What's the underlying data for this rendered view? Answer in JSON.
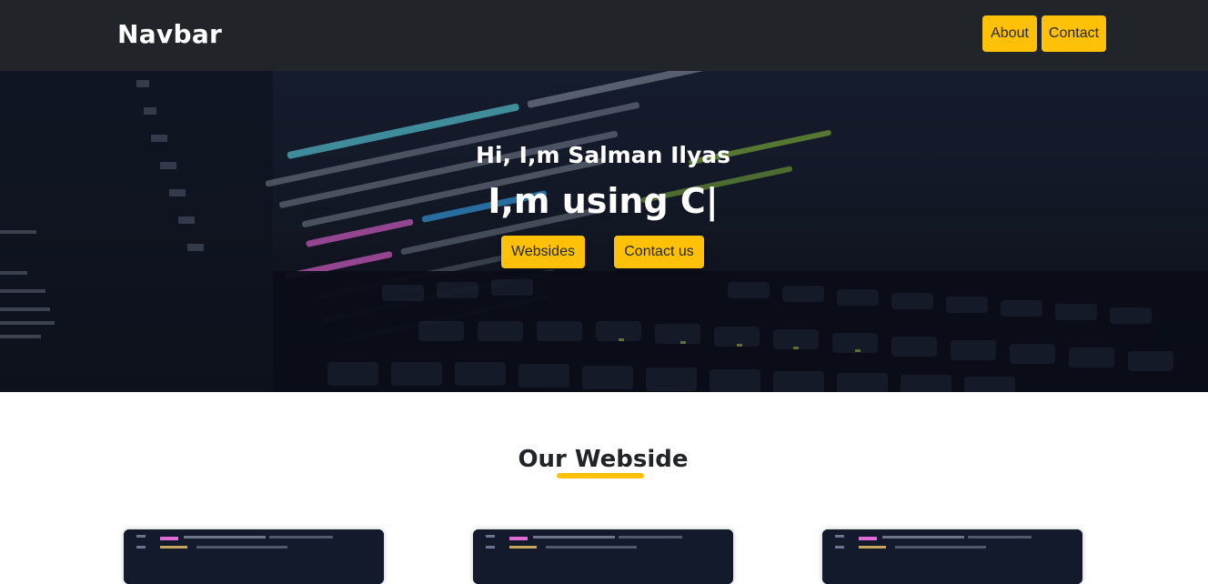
{
  "navbar": {
    "brand": "Navbar",
    "links": [
      {
        "label": "About"
      },
      {
        "label": "Contact"
      }
    ]
  },
  "hero": {
    "greeting": "Hi, I,m Salman Ilyas",
    "typing": "I,m using C|",
    "buttons": [
      {
        "label": "Websides"
      },
      {
        "label": "Contact us"
      }
    ]
  },
  "section": {
    "title": "Our Webside"
  },
  "colors": {
    "navbar_bg": "#212529",
    "accent": "#ffc107",
    "text_dark": "#212529"
  }
}
